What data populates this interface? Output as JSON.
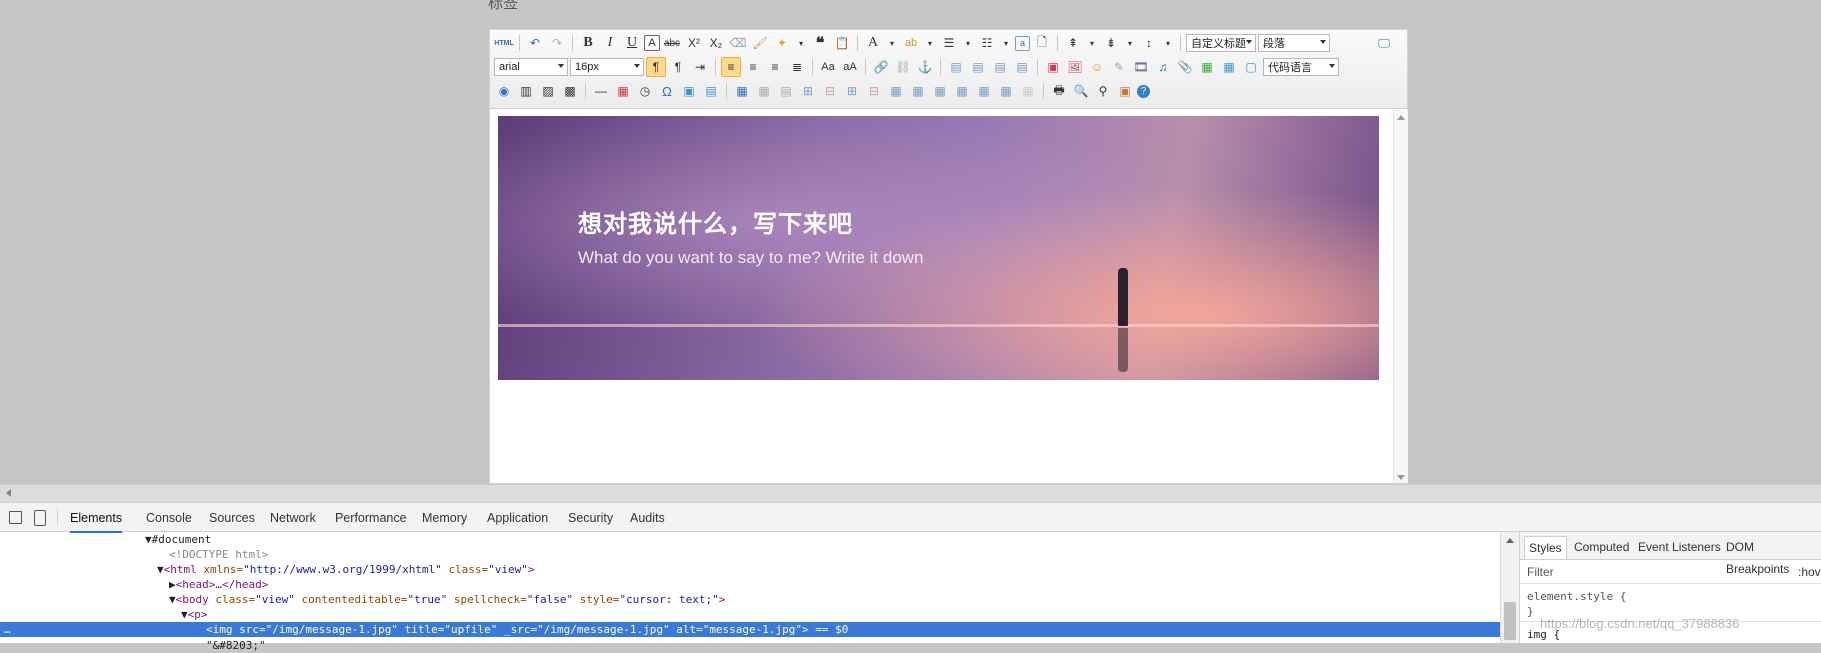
{
  "page": {
    "top_label": "标签"
  },
  "toolbar": {
    "font_family": "arial",
    "font_size": "16px",
    "custom_heading": "自定义标题",
    "paragraph": "段落",
    "code_language": "代码语言"
  },
  "content": {
    "banner_title": "想对我说什么，写下来吧",
    "banner_subtitle": "What do you want to say to me? Write it down"
  },
  "devtools": {
    "tabs": [
      "Elements",
      "Console",
      "Sources",
      "Network",
      "Performance",
      "Memory",
      "Application",
      "Security",
      "Audits"
    ],
    "selected_tab": "Elements",
    "dom_lines": {
      "document": "#document",
      "doctype": "<!DOCTYPE html>",
      "html_tag": "<html",
      "html_attr1": "xmlns=",
      "html_val1": "\"http://www.w3.org/1999/xhtml\"",
      "html_attr2": "class=",
      "html_val2": "\"view\"",
      "head": "<head>…</head>",
      "body_tag": "<body",
      "body_a1": "class=",
      "body_v1": "\"view\"",
      "body_a2": "contenteditable=",
      "body_v2": "\"true\"",
      "body_a3": "spellcheck=",
      "body_v3": "\"false\"",
      "body_a4": "style=",
      "body_v4": "\"cursor: text;\"",
      "p_tag": "<p>",
      "img_line": "<img src=\"/img/message-1.jpg\" title=\"upfile\" _src=\"/img/message-1.jpg\" alt=\"message-1.jpg\"> == $0",
      "next_line": "\"&#8203;\""
    },
    "styles_tabs": [
      "Styles",
      "Computed",
      "Event Listeners",
      "DOM Breakpoints"
    ],
    "filter_label": "Filter",
    "hov_label": ":hov",
    "element_style": "element.style {",
    "close_brace": "}",
    "img_rule": "img {"
  },
  "watermark": "https://blog.csdn.net/qq_37988836",
  "colors": {
    "accent": "#1a73e8",
    "selection": "#3879d9",
    "toolbar_active": "#ffd88a"
  }
}
